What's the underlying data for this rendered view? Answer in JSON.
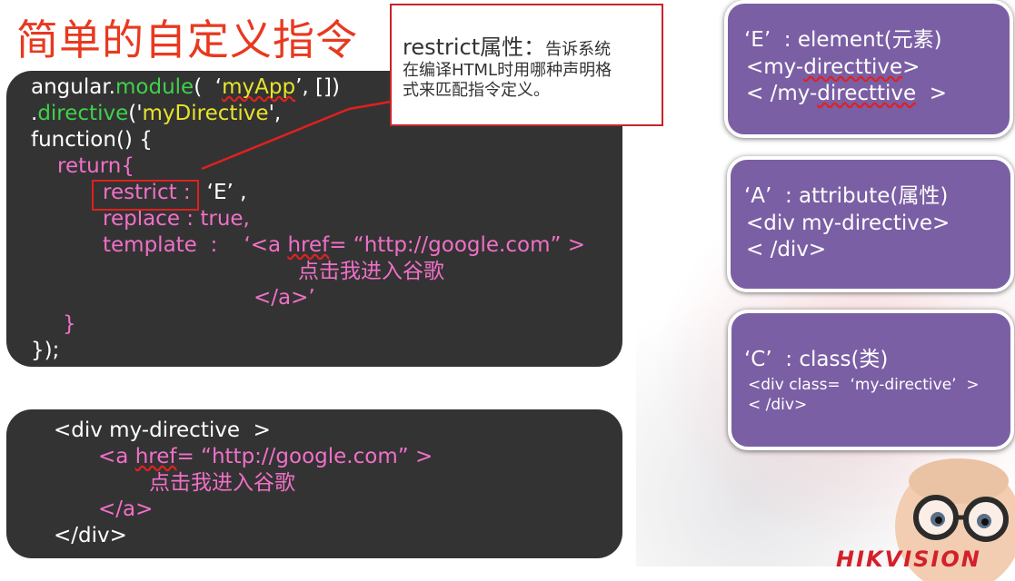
{
  "title": "简单的自定义指令",
  "callout": {
    "head": "restrict属性：",
    "head_tail": "告诉系统",
    "line2": "在编译HTML时用哪种声明格",
    "line3": "式来匹配指令定义。"
  },
  "code1": {
    "l1_a": "angular.",
    "l1_b": "module",
    "l1_c": "(  ‘",
    "l1_d": "myApp",
    "l1_e": "’, [])",
    "l2_a": ".",
    "l2_b": "directive",
    "l2_c": "('",
    "l2_d": "myDirective",
    "l2_e": "',",
    "l3": "function() {",
    "l4": "return{",
    "l5_a": "restrict :",
    "l5_b": "‘E’ ,",
    "l6": "replace : true,",
    "l7_a": "template  :    ‘<a ",
    "l7_b": "href",
    "l7_c": "= “http://google.com” >",
    "l8": "点击我进入谷歌",
    "l9": "</a>’",
    "l10": "}",
    "l11": "});"
  },
  "code2": {
    "l1": "<div my-directive  >",
    "l2_a": "<a ",
    "l2_b": "href",
    "l2_c": "= “http://google.com” >",
    "l3": "点击我进入谷歌",
    "l4": "</a>",
    "l5": "</div>"
  },
  "restrict_types": [
    {
      "l1": "‘E’  : element(元素)",
      "l2_a": "<my-",
      "l2_b": "directtive",
      "l2_c": ">",
      "l3_a": "< /my-",
      "l3_b": "directtive",
      "l3_c": "  >"
    },
    {
      "l1": "‘A’  : attribute(属性)",
      "l2": "<div my-directive>",
      "l3": "< /div>"
    },
    {
      "l1": "‘C’  : class(类)",
      "l2": "<div class=  ‘my-directive’  >",
      "l3": "< /div>"
    }
  ],
  "logo": "HIKVISION",
  "colors": {
    "title": "#e8391f",
    "code_bg": "#333333",
    "keyword_green": "#3fd14a",
    "string_yellow": "#e9e32b",
    "pink": "#f070c8",
    "purple_box": "#7b5fa4",
    "callout_border": "#c8242a"
  }
}
